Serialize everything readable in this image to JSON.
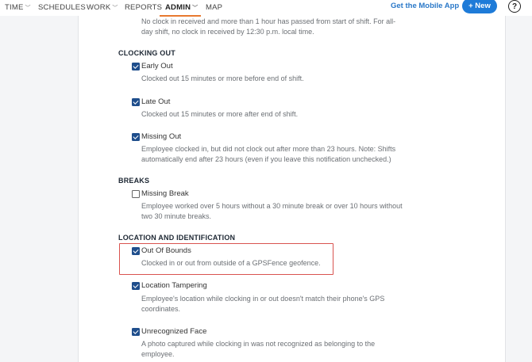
{
  "nav": {
    "time": "TIME",
    "schedules": "SCHEDULES",
    "work": "WORK",
    "reports": "REPORTS",
    "admin": "ADMIN",
    "map": "MAP",
    "mobile_app": "Get the Mobile App",
    "new_button": "+ New",
    "help": "?"
  },
  "top_desc": {
    "line1": "No clock in received and more than 1 hour has passed from start of shift. For all-",
    "line2": "day shift, no clock in received by 12:30 p.m. local time."
  },
  "clocking_out": {
    "title": "CLOCKING OUT",
    "early_out": {
      "label": "Early Out",
      "desc1": "Clocked out 15 minutes or more before end of shift.",
      "checked": true
    },
    "late_out": {
      "label": "Late Out",
      "desc1": "Clocked out 15 minutes or more after end of shift.",
      "checked": true
    },
    "missing_out": {
      "label": "Missing Out",
      "desc1": "Employee clocked in, but did not clock out after more than 23 hours. Note: Shifts",
      "desc2": "automatically end after 23 hours (even if you leave this notification unchecked.)",
      "checked": true
    }
  },
  "breaks": {
    "title": "BREAKS",
    "missing_break": {
      "label": "Missing Break",
      "desc1": "Employee worked over 5 hours without a 30 minute break or over 10 hours without",
      "desc2": "two 30 minute breaks.",
      "checked": false
    }
  },
  "location": {
    "title": "LOCATION AND IDENTIFICATION",
    "out_of_bounds": {
      "label": "Out Of Bounds",
      "desc1": "Clocked in or out from outside of a GPSFence geofence.",
      "checked": true
    },
    "location_tampering": {
      "label": "Location Tampering",
      "desc1": "Employee's location while clocking in or out doesn't match their phone's GPS",
      "desc2": "coordinates.",
      "checked": true
    },
    "unrecognized_face": {
      "label": "Unrecognized Face",
      "desc1": "A photo captured while clocking in was not recognized as belonging to the",
      "desc2": "employee.",
      "checked": true
    }
  },
  "colors": {
    "accent": "#1e7bd8",
    "checkbox": "#1f4e8c",
    "highlight": "#d9534f",
    "active_tab_underline": "#e8792f"
  }
}
